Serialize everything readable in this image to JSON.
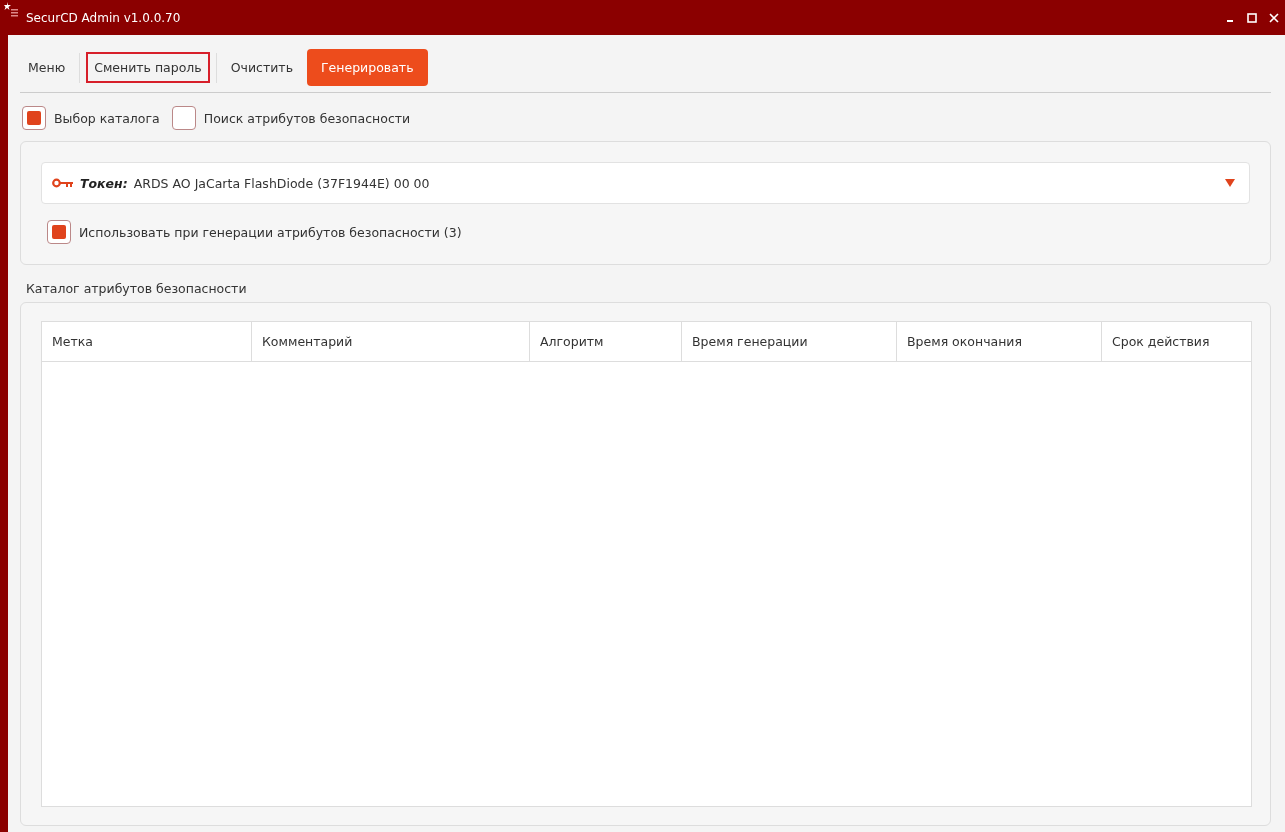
{
  "window": {
    "title": "SecurCD Admin v1.0.0.70"
  },
  "toolbar": [
    {
      "label": "Меню",
      "kind": "plain",
      "highlighted": false
    },
    {
      "label": "Сменить пароль",
      "kind": "plain",
      "highlighted": true
    },
    {
      "label": "Очистить",
      "kind": "plain",
      "highlighted": false
    },
    {
      "label": "Генерировать",
      "kind": "primary",
      "highlighted": false
    }
  ],
  "mode_options": [
    {
      "label": "Выбор каталога",
      "checked": true
    },
    {
      "label": "Поиск атрибутов безопасности",
      "checked": false
    }
  ],
  "token": {
    "label": "Токен:",
    "value": "ARDS AO JaCarta FlashDiode (37F1944E) 00 00"
  },
  "use_option": {
    "label": "Использовать при генерации атрибутов безопасности (3)",
    "checked": true
  },
  "catalog": {
    "title": "Каталог атрибутов безопасности",
    "columns": [
      "Метка",
      "Комментарий",
      "Алгоритм",
      "Время генерации",
      "Время окончания",
      "Срок действия"
    ]
  }
}
